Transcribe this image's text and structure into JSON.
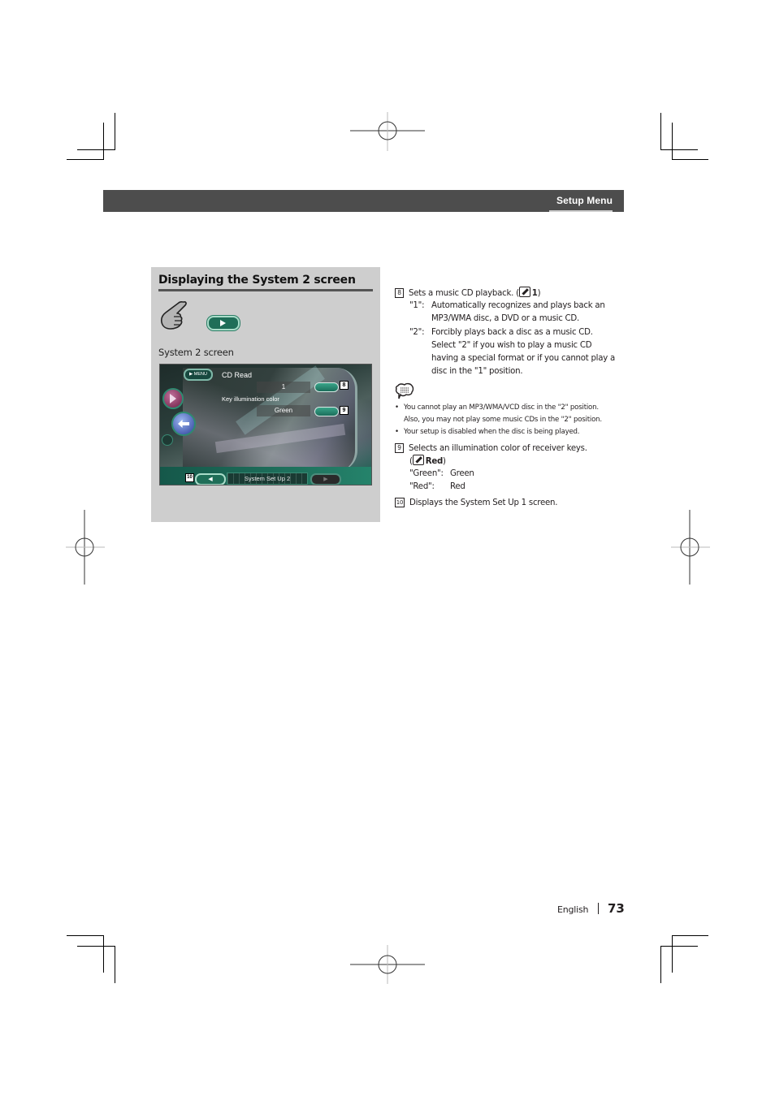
{
  "header": {
    "section_title": "Setup Menu"
  },
  "left_panel": {
    "title": "Displaying the System 2 screen",
    "hand_icon": "pointing-hand-icon",
    "play_button_icon": "play-triangle-icon",
    "caption": "System 2 screen",
    "screen": {
      "menu_button": "▶ MENU",
      "cd_read_label": "CD Read",
      "cd_read_value": "1",
      "key_color_label": "Key illumination color",
      "key_color_value": "Green",
      "page_label": "System Set Up 2",
      "prev_icon": "◀",
      "next_icon": "▶",
      "callouts": [
        "8",
        "9",
        "10"
      ]
    }
  },
  "right_column": {
    "item8": {
      "number": "8",
      "text": "Sets a music CD playback. (",
      "default_value": "1",
      "close": ")",
      "options": [
        {
          "key": "\"1\":",
          "lines": [
            "Automatically recognizes and plays back an",
            "MP3/WMA disc, a DVD or a music CD."
          ]
        },
        {
          "key": "\"2\":",
          "lines": [
            "Forcibly plays back a disc as a music CD.",
            "Select \"2\" if you wish to play a music CD",
            "having a special format or if you cannot play a",
            "disc in the \"1\" position."
          ]
        }
      ]
    },
    "note_icon": "note-speech-bubble-icon",
    "notes": [
      [
        "You cannot play an MP3/WMA/VCD disc in the \"2\" position.",
        "Also, you may not play some music CDs in the \"2\" position."
      ],
      [
        "Your setup is disabled when the disc is being played."
      ]
    ],
    "item9": {
      "number": "9",
      "text": "Selects an illumination color of receiver keys.",
      "open": "(",
      "default_value": "Red",
      "close": ")",
      "options": [
        {
          "key": "\"Green\":",
          "value": "Green"
        },
        {
          "key": "\"Red\":",
          "value": "Red"
        }
      ]
    },
    "item10": {
      "number": "10",
      "text": "Displays the System Set Up 1 screen."
    }
  },
  "footer": {
    "language": "English",
    "page_number": "73"
  }
}
